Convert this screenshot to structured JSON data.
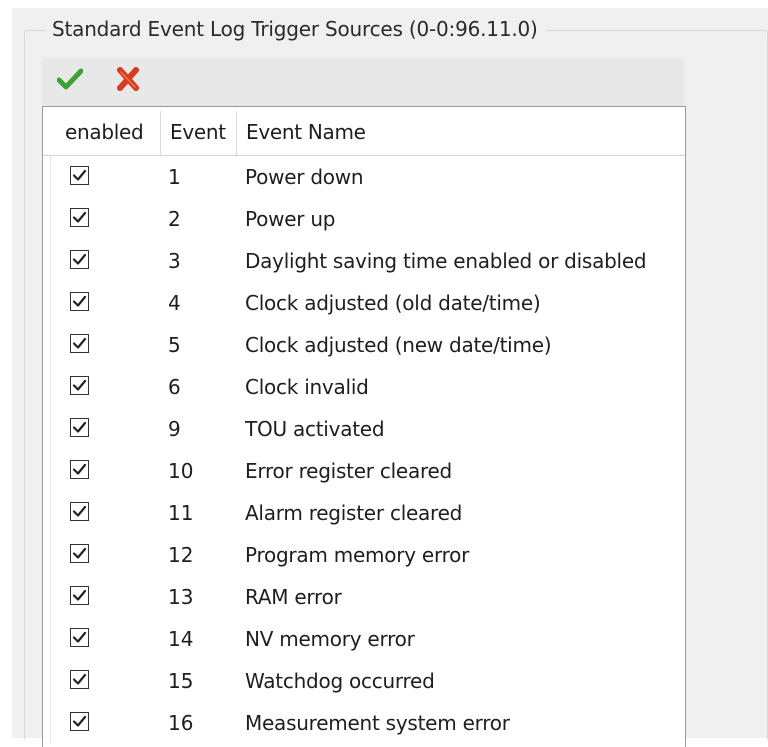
{
  "groupbox": {
    "title": "Standard Event Log Trigger Sources (0-0:96.11.0)"
  },
  "toolbar": {
    "accept_icon": "checkmark-icon",
    "cancel_icon": "x-icon",
    "accept_color": "#3aa335",
    "cancel_color": "#d83a1e"
  },
  "grid": {
    "columns": [
      "enabled",
      "Event",
      "Event Name"
    ],
    "rows": [
      {
        "enabled": true,
        "event": "1",
        "name": "Power down"
      },
      {
        "enabled": true,
        "event": "2",
        "name": "Power up"
      },
      {
        "enabled": true,
        "event": "3",
        "name": "Daylight saving time enabled or disabled"
      },
      {
        "enabled": true,
        "event": "4",
        "name": "Clock adjusted (old date/time)"
      },
      {
        "enabled": true,
        "event": "5",
        "name": "Clock adjusted (new date/time)"
      },
      {
        "enabled": true,
        "event": "6",
        "name": "Clock invalid"
      },
      {
        "enabled": true,
        "event": "9",
        "name": "TOU activated"
      },
      {
        "enabled": true,
        "event": "10",
        "name": "Error register cleared"
      },
      {
        "enabled": true,
        "event": "11",
        "name": "Alarm register cleared"
      },
      {
        "enabled": true,
        "event": "12",
        "name": "Program memory error"
      },
      {
        "enabled": true,
        "event": "13",
        "name": "RAM error"
      },
      {
        "enabled": true,
        "event": "14",
        "name": "NV memory error"
      },
      {
        "enabled": true,
        "event": "15",
        "name": "Watchdog occurred"
      },
      {
        "enabled": true,
        "event": "16",
        "name": "Measurement system error"
      }
    ]
  }
}
